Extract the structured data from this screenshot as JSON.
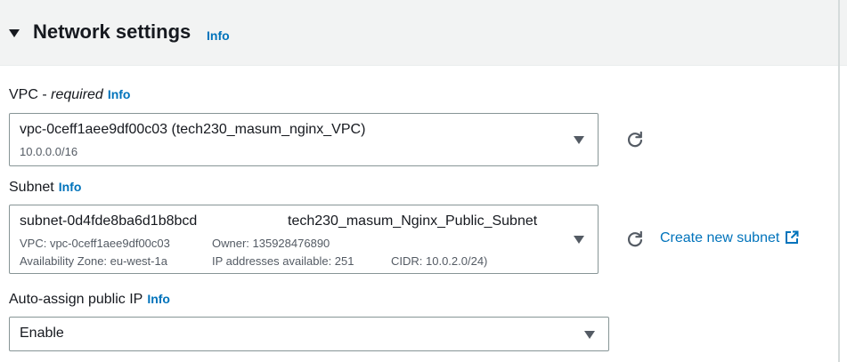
{
  "section": {
    "title": "Network settings",
    "info": "Info"
  },
  "vpc": {
    "label": "VPC - ",
    "required": "required",
    "info": "Info",
    "value": "vpc-0ceff1aee9df00c03 (tech230_masum_nginx_VPC)",
    "cidr": "10.0.0.0/16"
  },
  "subnet": {
    "label": "Subnet",
    "info": "Info",
    "id": "subnet-0d4fde8ba6d1b8bcd",
    "name": "tech230_masum_Nginx_Public_Subnet",
    "vpc_line": "VPC: vpc-0ceff1aee9df00c03",
    "owner_line": "Owner: 135928476890",
    "az_line": "Availability Zone: eu-west-1a",
    "ips_line": "IP addresses available: 251",
    "cidr_line": "CIDR: 10.0.2.0/24)",
    "create_link": "Create new subnet"
  },
  "auto_assign": {
    "label": "Auto-assign public IP",
    "info": "Info",
    "value": "Enable"
  },
  "icons": {
    "expand": "caret-down-icon",
    "dropdown": "triangle-down-icon",
    "refresh": "refresh-icon",
    "external": "external-link-icon"
  },
  "colors": {
    "link": "#0073bb",
    "text": "#16191f",
    "muted": "#545b64",
    "border": "#879596",
    "header_bg": "#f2f3f3"
  }
}
